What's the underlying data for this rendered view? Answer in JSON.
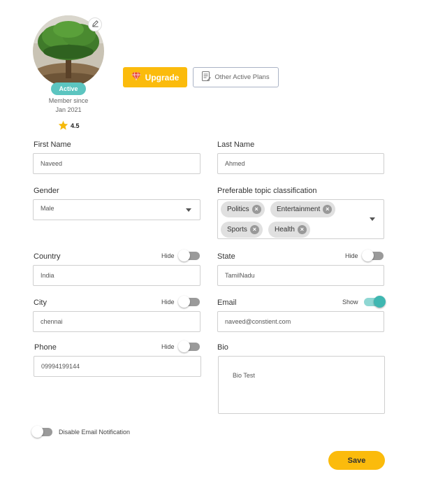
{
  "profile": {
    "status_badge": "Active",
    "member_since_line1": "Member since",
    "member_since_line2": "Jan 2021",
    "rating": "4.5"
  },
  "plans": {
    "upgrade_label": "Upgrade",
    "other_plans_label": "Other Active Plans"
  },
  "form": {
    "first_name": {
      "label": "First Name",
      "value": "Naveed"
    },
    "last_name": {
      "label": "Last Name",
      "value": "Ahmed"
    },
    "gender": {
      "label": "Gender",
      "value": "Male"
    },
    "topics": {
      "label": "Preferable topic classification",
      "chips": [
        "Politics",
        "Entertainment",
        "Sports",
        "Health"
      ]
    },
    "country": {
      "label": "Country",
      "value": "India",
      "visibility_label": "Hide",
      "visible": false
    },
    "state": {
      "label": "State",
      "value": "TamilNadu",
      "visibility_label": "Hide",
      "visible": false
    },
    "city": {
      "label": "City",
      "value": "chennai",
      "visibility_label": "Hide",
      "visible": false
    },
    "email": {
      "label": "Email",
      "value": "naveed@constient.com",
      "visibility_label": "Show",
      "visible": true
    },
    "phone": {
      "label": "Phone",
      "value": "09994199144",
      "visibility_label": "Hide",
      "visible": false
    },
    "bio": {
      "label": "Bio",
      "value": "Bio Test"
    },
    "email_notification": {
      "label": "Disable Email Notification",
      "enabled": false
    },
    "save_label": "Save"
  },
  "colors": {
    "accent_yellow": "#fbbb0c",
    "teal": "#5cc5c0",
    "toggle_off": "#9a9a9a"
  },
  "icons": {
    "edit": "pencil-icon",
    "upgrade": "diamond-icon",
    "plans": "document-icon",
    "rating": "star-icon",
    "chip_remove": "close-circle-icon",
    "dropdown": "caret-down-icon"
  }
}
